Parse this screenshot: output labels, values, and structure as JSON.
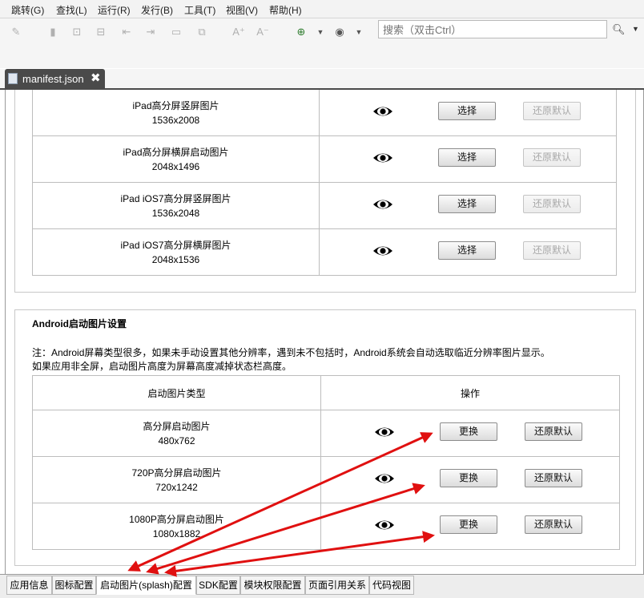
{
  "menu": [
    "跳转(G)",
    "查找(L)",
    "运行(R)",
    "发行(B)",
    "工具(T)",
    "视图(V)",
    "帮助(H)"
  ],
  "search": {
    "placeholder": "搜索（双击Ctrl）"
  },
  "file_tab": {
    "name": "manifest.json",
    "close": "✖"
  },
  "ios_rows": [
    {
      "name": "iPad高分屏竖屏图片",
      "size": "1536x2008",
      "select": "选择",
      "reset": "还原默认"
    },
    {
      "name": "iPad高分屏横屏启动图片",
      "size": "2048x1496",
      "select": "选择",
      "reset": "还原默认"
    },
    {
      "name": "iPad iOS7高分屏竖屏图片",
      "size": "1536x2048",
      "select": "选择",
      "reset": "还原默认"
    },
    {
      "name": "iPad iOS7高分屏横屏图片",
      "size": "2048x1536",
      "select": "选择",
      "reset": "还原默认"
    }
  ],
  "android": {
    "title": "Android启动图片设置",
    "note1": "注：Android屏幕类型很多，如果未手动设置其他分辨率，遇到未不包括时，Android系统会自动选取临近分辨率图片显示。",
    "note2": "如果应用非全屏，启动图片高度为屏幕高度减掉状态栏高度。",
    "col_type": "启动图片类型",
    "col_action": "操作",
    "rows": [
      {
        "name": "高分屏启动图片",
        "size": "480x762",
        "replace": "更换",
        "reset": "还原默认"
      },
      {
        "name": "720P高分屏启动图片",
        "size": "720x1242",
        "replace": "更换",
        "reset": "还原默认"
      },
      {
        "name": "1080P高分屏启动图片",
        "size": "1080x1882",
        "replace": "更换",
        "reset": "还原默认"
      }
    ]
  },
  "bottom_tabs": [
    "应用信息",
    "图标配置",
    "启动图片(splash)配置",
    "SDK配置",
    "模块权限配置",
    "页面引用关系",
    "代码视图"
  ],
  "colors": {
    "tab_active": "#4a4a4a",
    "arrow": "#e01010",
    "toolbar_active": "#2f7d2f"
  },
  "icons": [
    "eye-icon",
    "search-icon",
    "file-icon",
    "close-icon"
  ]
}
